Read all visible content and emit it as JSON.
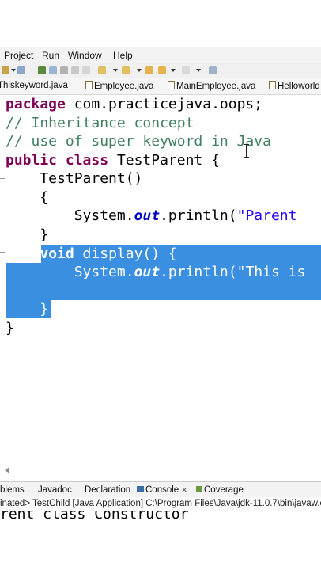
{
  "menu": [
    "Project",
    "Run",
    "Window",
    "Help"
  ],
  "tabs": [
    "Thiskeyword.java",
    "Employee.java",
    "MainEmployee.java",
    "Helloworld"
  ],
  "code": {
    "l1_kw": "package",
    "l1_rest": " com.practicejava.oops;",
    "l2": "// Inheritance concept",
    "l3": "// use of super keyword in Java",
    "l4_kw1": "public",
    "l4_kw2": "class",
    "l4_rest": " TestParent {",
    "l5": "    TestParent()",
    "l6": "    {",
    "l7_a": "        System.",
    "l7_field": "out",
    "l7_b": ".println(",
    "l7_str": "\"Parent",
    "l8": "    }",
    "l9_kw": "void",
    "l9_rest": " display() {",
    "l10_a": "        System.",
    "l10_field": "out",
    "l10_b": ".println(",
    "l10_str": "\"This is",
    "l12": "    }",
    "l13": "}"
  },
  "bottom_tabs": [
    "blems",
    "Javadoc",
    "Declaration",
    "Console",
    "Coverage"
  ],
  "console_close": "✕",
  "console_header": "inated> TestChild [Java Application] C:\\Program Files\\Java\\jdk-11.0.7\\bin\\javaw.e",
  "console_output": "rent class Constructor",
  "colors": {
    "selection": "#3b8fe0",
    "keyword": "#7f0055",
    "comment": "#3f7f5f",
    "string": "#2a00ff"
  }
}
